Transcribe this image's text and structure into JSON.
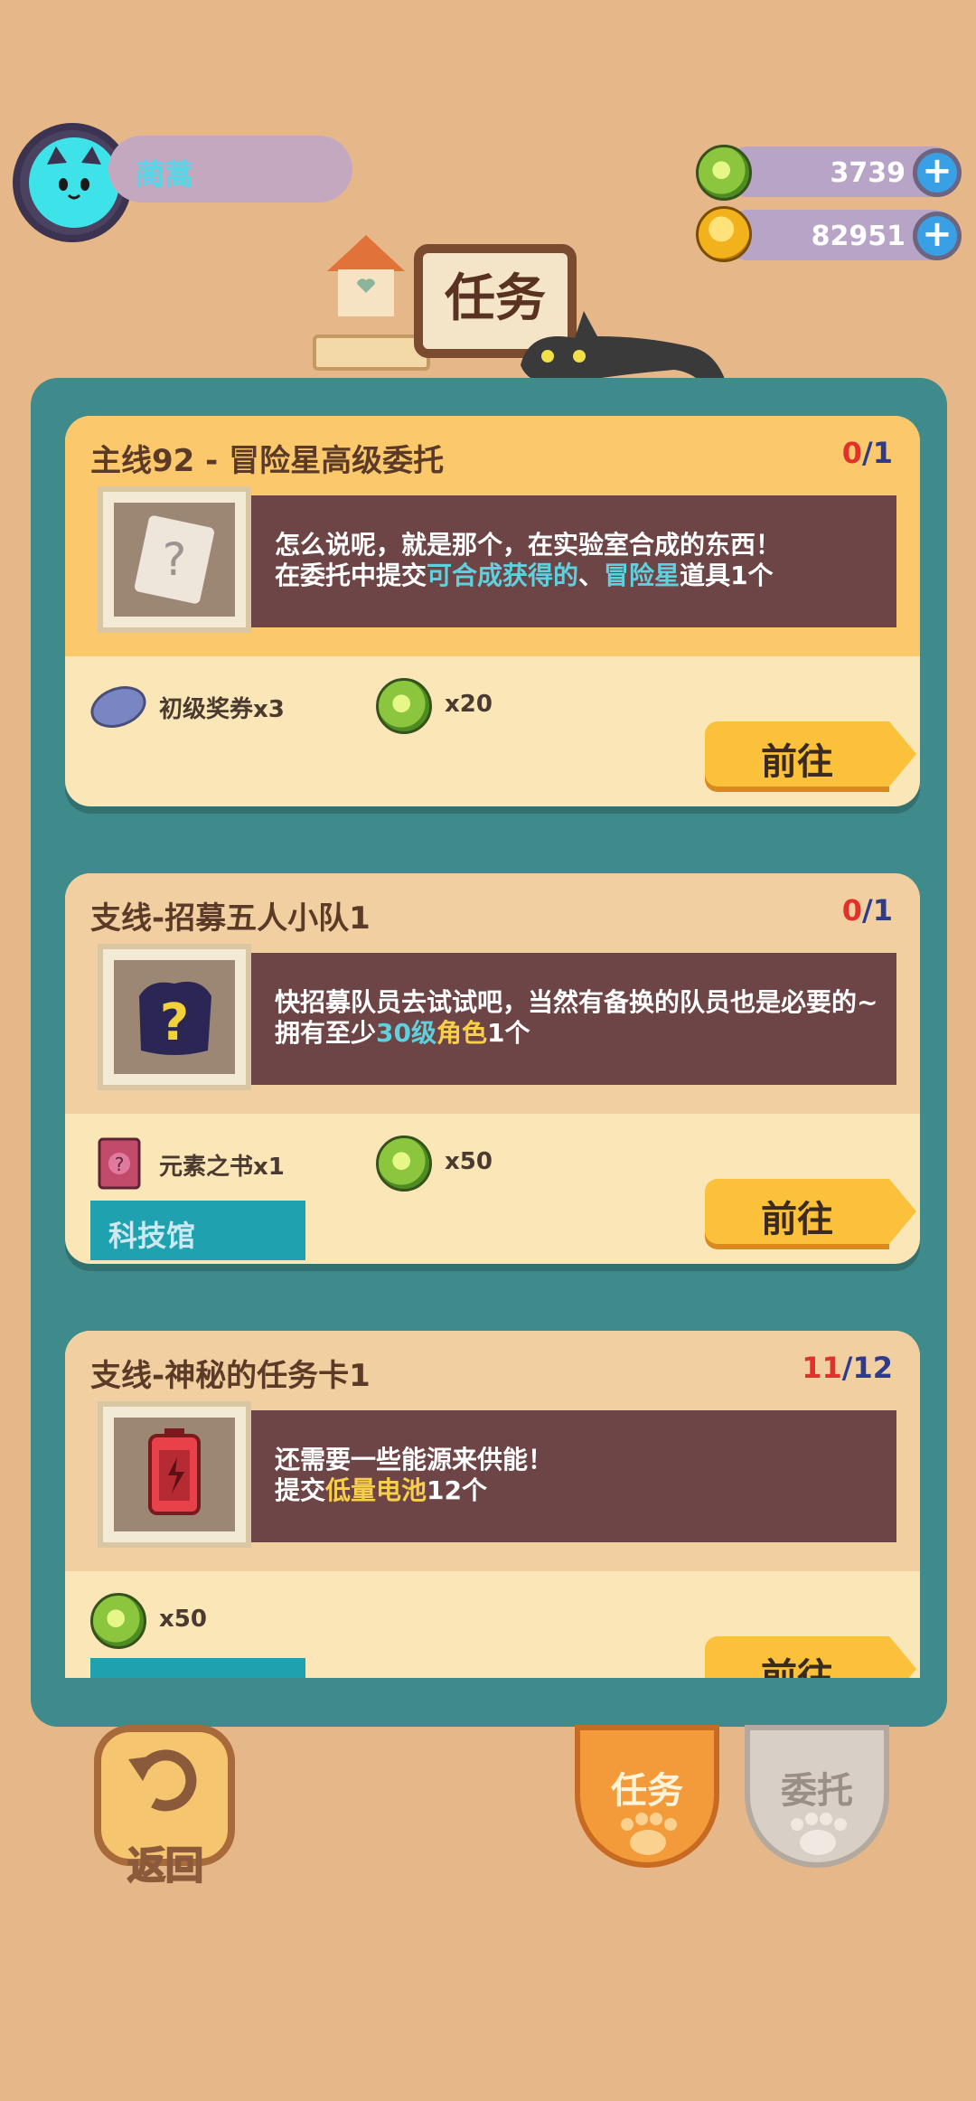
{
  "player": {
    "name": "蔺蒿"
  },
  "currencies": [
    {
      "name": "green-coin",
      "value": "3739"
    },
    {
      "name": "gold-coin",
      "value": "82951"
    }
  ],
  "header": {
    "title": "任务"
  },
  "tasks": [
    {
      "title": "主线92 - 冒险星高级委托",
      "progress_current": "0",
      "progress_total": "/1",
      "desc_line1": "怎么说呢，就是那个，在实验室合成的东西！",
      "desc_line2_a": "在委托中提交",
      "desc_line2_b": "可合成获得的",
      "desc_line2_c": "、",
      "desc_line2_d": "冒险星",
      "desc_line2_e": "道具1个",
      "rewards": [
        {
          "icon": "ticket-icon",
          "text": "初级奖券x3"
        },
        {
          "icon": "green-coin-icon",
          "text": "x20"
        }
      ],
      "go_label": "前往"
    },
    {
      "title": "支线-招募五人小队1",
      "progress_current": "0",
      "progress_total": "/1",
      "desc_line1": "快招募队员去试试吧，当然有备换的队员也是必要的~",
      "desc_line2_a": "拥有至少",
      "desc_line2_b": "30级",
      "desc_line2_c": "角色",
      "desc_line2_d": "1个",
      "rewards": [
        {
          "icon": "element-book-icon",
          "text": "元素之书x1"
        },
        {
          "icon": "green-coin-icon",
          "text": "x50"
        }
      ],
      "location": "科技馆",
      "go_label": "前往"
    },
    {
      "title": "支线-神秘的任务卡1",
      "progress_current": "11",
      "progress_total": "/12",
      "desc_line1": "还需要一些能源来供能！",
      "desc_line2_a": "提交",
      "desc_line2_b": "低量电池",
      "desc_line2_c": "12个",
      "rewards": [
        {
          "icon": "green-coin-icon",
          "text": "x50"
        }
      ],
      "go_label": "前往"
    }
  ],
  "nav": {
    "back": "返回",
    "tab_tasks": "任务",
    "tab_commission": "委托"
  },
  "colors": {
    "background": "#e6b889",
    "panel": "#3f8a8a",
    "highlight_cyan": "#5fd1de",
    "highlight_yellow": "#f7cf4a"
  }
}
